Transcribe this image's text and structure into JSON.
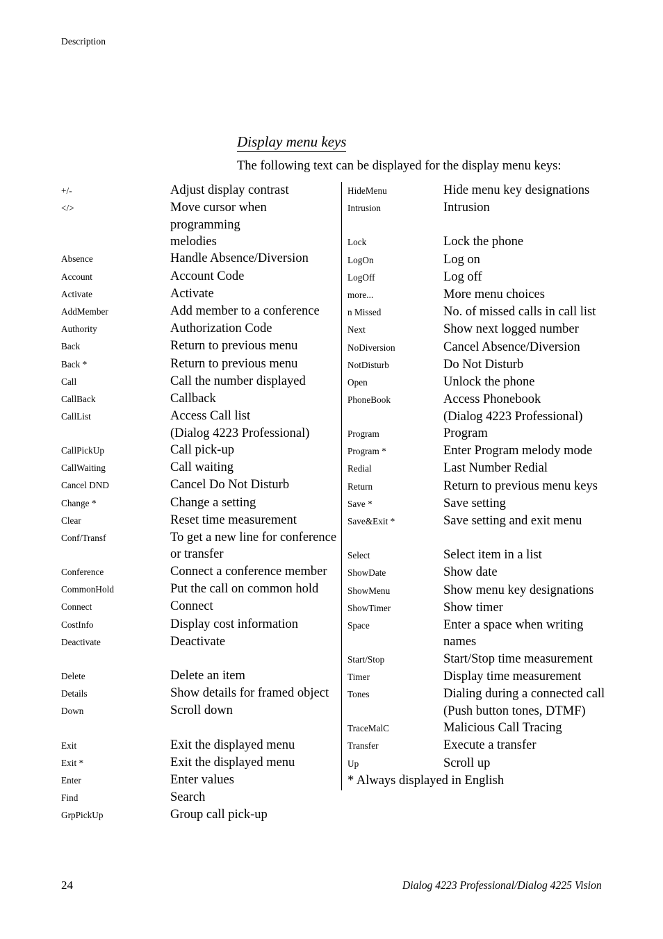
{
  "running_header": "Description",
  "heading": "Display menu keys",
  "intro": "The following text can be displayed for the display menu keys:",
  "left_column": [
    {
      "key": "+/-",
      "desc": "Adjust display contrast"
    },
    {
      "key": "</>",
      "desc": "Move cursor when programming\nmelodies",
      "two_line": true
    },
    {
      "key": "Absence",
      "desc": "Handle Absence/Diversion"
    },
    {
      "key": "Account",
      "desc": "Account Code"
    },
    {
      "key": "Activate",
      "desc": "Activate"
    },
    {
      "key": "AddMember",
      "desc": "Add member to a conference"
    },
    {
      "key": "Authority",
      "desc": "Authorization Code"
    },
    {
      "key": "Back",
      "desc": "Return to previous menu"
    },
    {
      "key": "Back *",
      "desc": "Return to previous menu"
    },
    {
      "key": "Call",
      "desc": "Call the number displayed"
    },
    {
      "key": "CallBack",
      "desc": "Callback"
    },
    {
      "key": "CallList",
      "desc": "Access Call list\n(Dialog 4223 Professional)",
      "two_line": true
    },
    {
      "key": "CallPickUp",
      "desc": "Call pick-up"
    },
    {
      "key": "CallWaiting",
      "desc": "Call waiting"
    },
    {
      "key": "Cancel DND",
      "desc": "Cancel Do Not Disturb"
    },
    {
      "key": "Change *",
      "desc": "Change a setting"
    },
    {
      "key": "Clear",
      "desc": "Reset time measurement"
    },
    {
      "key": "Conf/Transf",
      "desc": "To get a new line for conference\nor transfer",
      "two_line": true
    },
    {
      "key": "Conference",
      "desc": "Connect a conference member"
    },
    {
      "key": "CommonHold",
      "desc": "Put the call on common hold"
    },
    {
      "key": "Connect",
      "desc": "Connect"
    },
    {
      "key": "CostInfo",
      "desc": "Display cost information"
    },
    {
      "key": "Deactivate",
      "desc": "Deactivate"
    },
    {
      "key": "Delete",
      "desc": "Delete an item",
      "gap_before": true
    },
    {
      "key": "Details",
      "desc": "Show details for framed object"
    },
    {
      "key": "Down",
      "desc": "Scroll down"
    },
    {
      "key": "Exit",
      "desc": "Exit the displayed menu",
      "gap_before": true
    },
    {
      "key": "Exit *",
      "desc": "Exit the displayed menu"
    },
    {
      "key": "Enter",
      "desc": "Enter values"
    },
    {
      "key": "Find",
      "desc": "Search"
    },
    {
      "key": "GrpPickUp",
      "desc": "Group call pick-up"
    }
  ],
  "right_column": [
    {
      "key": "HideMenu",
      "desc": "Hide menu key designations"
    },
    {
      "key": "Intrusion",
      "desc": "Intrusion"
    },
    {
      "key": "Lock",
      "desc": "Lock the phone",
      "gap_before": true
    },
    {
      "key": "LogOn",
      "desc": "Log on"
    },
    {
      "key": "LogOff",
      "desc": "Log off"
    },
    {
      "key": "more...",
      "desc": "More menu choices"
    },
    {
      "key": "n Missed",
      "desc": "No. of missed calls in call list"
    },
    {
      "key": "Next",
      "desc": "Show next logged number"
    },
    {
      "key": "NoDiversion",
      "desc": "Cancel Absence/Diversion"
    },
    {
      "key": "NotDisturb",
      "desc": "Do Not Disturb"
    },
    {
      "key": "Open",
      "desc": "Unlock the phone"
    },
    {
      "key": "PhoneBook",
      "desc": "Access Phonebook\n(Dialog 4223 Professional)",
      "two_line": true
    },
    {
      "key": "Program",
      "desc": "Program"
    },
    {
      "key": "Program *",
      "desc": "Enter Program melody mode"
    },
    {
      "key": "Redial",
      "desc": "Last Number Redial"
    },
    {
      "key": "Return",
      "desc": "Return to previous menu keys"
    },
    {
      "key": "Save *",
      "desc": "Save setting"
    },
    {
      "key": "Save&Exit *",
      "desc": "Save setting and exit menu"
    },
    {
      "key": "Select",
      "desc": "Select item in a list",
      "gap_before": true
    },
    {
      "key": "ShowDate",
      "desc": "Show date"
    },
    {
      "key": "ShowMenu",
      "desc": "Show menu key designations"
    },
    {
      "key": "ShowTimer",
      "desc": "Show timer"
    },
    {
      "key": "Space",
      "desc": "Enter a space when writing\nnames",
      "two_line": true
    },
    {
      "key": "Start/Stop",
      "desc": "Start/Stop time measurement"
    },
    {
      "key": "Timer",
      "desc": "Display time measurement"
    },
    {
      "key": "Tones",
      "desc": "Dialing during a connected call\n(Push button tones, DTMF)",
      "two_line": true
    },
    {
      "key": "TraceMalC",
      "desc": "Malicious Call Tracing"
    },
    {
      "key": "Transfer",
      "desc": "Execute a transfer"
    },
    {
      "key": "Up",
      "desc": "Scroll up"
    }
  ],
  "footnote": "* Always displayed in English",
  "footer": {
    "page_number": "24",
    "document_title": "Dialog 4223 Professional/Dialog 4225 Vision"
  }
}
